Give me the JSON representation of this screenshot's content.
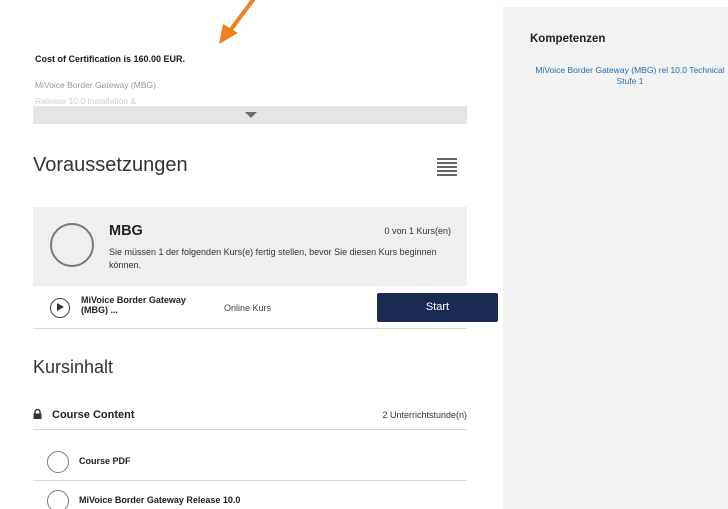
{
  "course": {
    "cost_text": "Cost of Certification is 160.00 EUR.",
    "description_line1": "MiVoice Border Gateway (MBG)",
    "description_line2": "Release 10.0 Installation &"
  },
  "prerequisites": {
    "heading": "Voraussetzungen",
    "group": {
      "title": "MBG",
      "count": "0 von 1 Kurs(en)",
      "message": "Sie müssen 1 der folgenden Kurs(e) fertig stellen, bevor Sie diesen Kurs beginnen können."
    },
    "course": {
      "name": "MiVoice Border Gateway (MBG) ...",
      "type": "Online Kurs",
      "action": "Start"
    }
  },
  "course_content": {
    "heading": "Kursinhalt",
    "section_title": "Course Content",
    "section_count": "2 Unterrichtstunde(n)",
    "items": [
      {
        "label": "Course PDF"
      },
      {
        "label": "MiVoice Border Gateway Release 10.0"
      }
    ]
  },
  "competencies": {
    "title": "Kompetenzen",
    "link_text": "MiVoice Border Gateway (MBG) rel 10.0 Technical Stufe 1"
  },
  "colors": {
    "accent": "#f07f1e",
    "button": "#1b2a52",
    "link": "#2b6cb0"
  },
  "icons": [
    "arrow-annotation-icon",
    "chevron-down-icon",
    "list-menu-icon",
    "play-icon",
    "more-vertical-icon",
    "lock-icon"
  ]
}
